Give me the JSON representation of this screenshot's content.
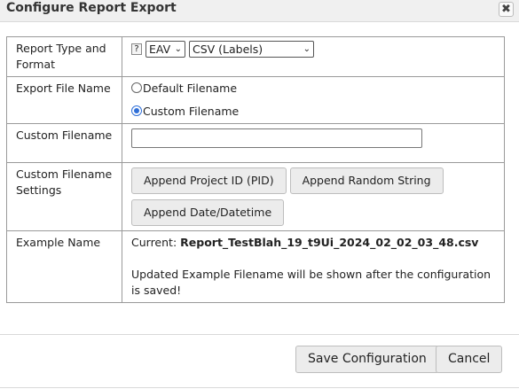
{
  "dialog": {
    "title": "Configure Report Export",
    "close_glyph": "✖"
  },
  "rows": {
    "type_format": {
      "label": "Report Type and Format",
      "help_glyph": "?",
      "type_value": "EAV",
      "format_value": "CSV (Labels)"
    },
    "file_name": {
      "label": "Export File Name",
      "option_default": "Default Filename",
      "option_custom": "Custom Filename",
      "selected": "custom"
    },
    "custom_filename": {
      "label": "Custom Filename",
      "value": ""
    },
    "filename_settings": {
      "label": "Custom Filename Settings",
      "btn_pid": "Append Project ID (PID)",
      "btn_random": "Append Random String",
      "btn_date": "Append Date/Datetime"
    },
    "example": {
      "label": "Example Name",
      "current_prefix": "Current:",
      "current_value": "Report_TestBlah_19_t9Ui_2024_02_02_03_48.csv",
      "note": "Updated Example Filename will be shown after the configuration is saved!"
    }
  },
  "footer": {
    "save_label": "Save Configuration",
    "cancel_label": "Cancel"
  },
  "icons": {
    "help": "help-icon",
    "close": "close-icon",
    "dropdown": "chevron-down-icon"
  }
}
